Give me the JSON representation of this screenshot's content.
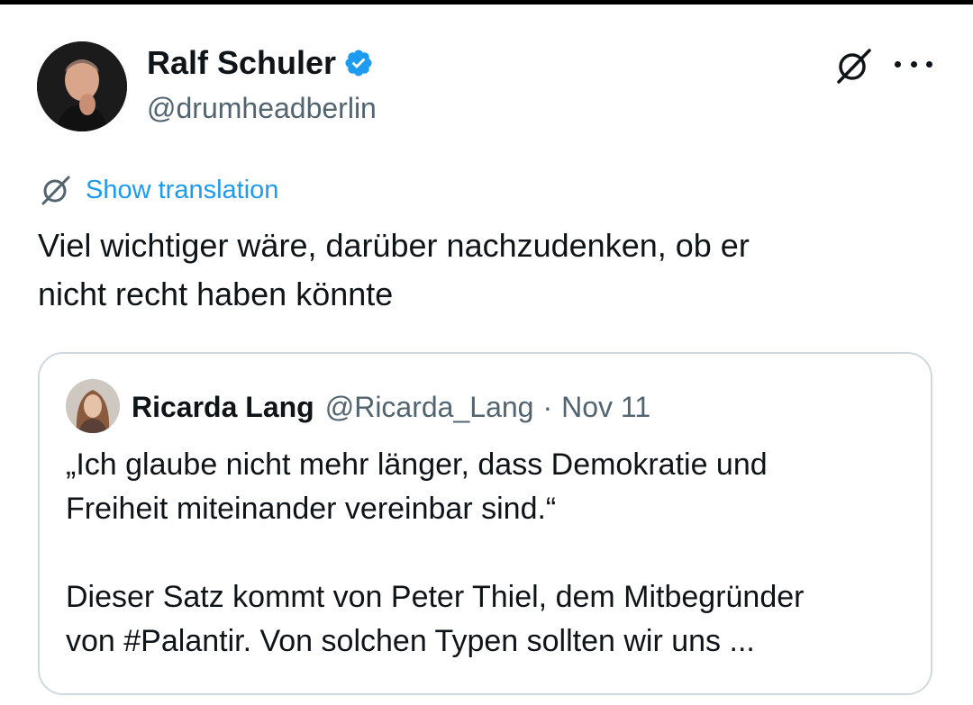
{
  "tweet": {
    "author_name": "Ralf Schuler",
    "author_handle": "@drumheadberlin",
    "translate_label": "Show translation",
    "text_line1": "Viel wichtiger wäre, darüber nachzudenken, ob er",
    "text_line2": "nicht recht haben könnte"
  },
  "quote": {
    "author_name": "Ricarda Lang",
    "author_handle": "@Ricarda_Lang",
    "separator": "·",
    "date": "Nov 11",
    "line1": "„Ich glaube nicht mehr länger, dass Demokratie und",
    "line2": "Freiheit miteinander vereinbar sind.“",
    "line3": "Dieser Satz kommt von Peter Thiel, dem Mitbegründer",
    "line4": "von #Palantir. Von solchen Typen sollten wir uns ..."
  },
  "icons": {
    "verified": "verified-badge-icon",
    "grok": "grok-icon",
    "more": "more-options-icon",
    "translate": "translate-grok-icon"
  },
  "colors": {
    "accent": "#1d9bf0",
    "secondary_text": "#536471",
    "border": "#cfd9de",
    "primary_text": "#0f1419"
  }
}
